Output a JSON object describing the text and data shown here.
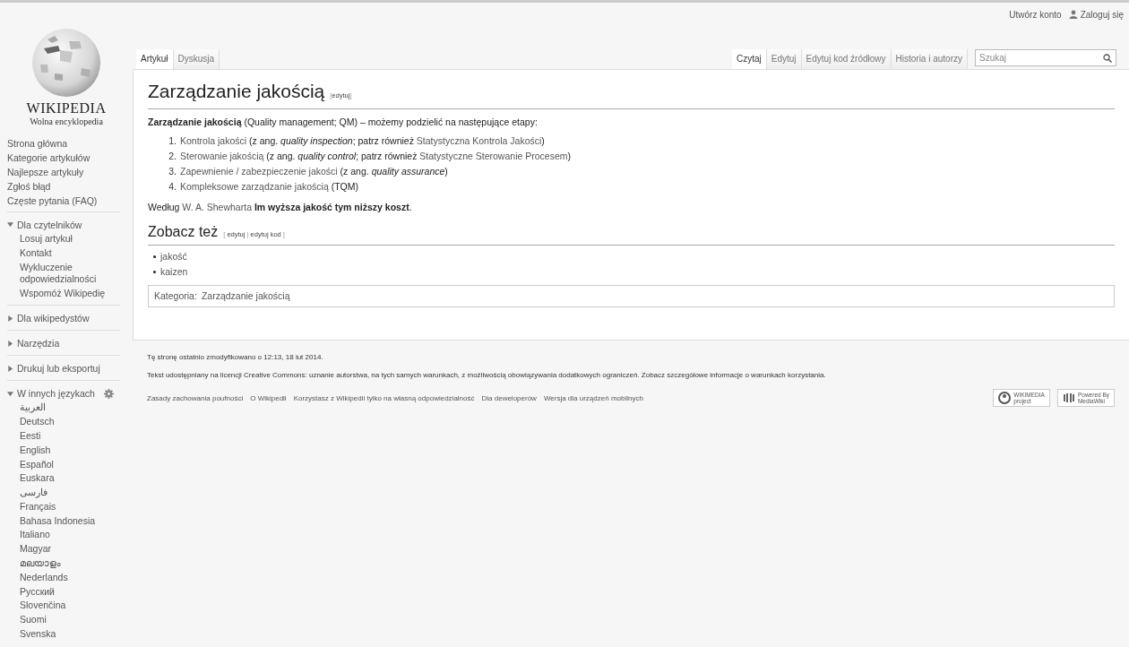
{
  "logo": {
    "wordmark": "WIKIPEDIA",
    "tagline": "Wolna encyklopedia"
  },
  "personal_links": [
    {
      "label": "Utwórz konto",
      "kind": "plain"
    },
    {
      "label": "Zaloguj się",
      "kind": "user"
    }
  ],
  "left_tabs": [
    {
      "label": "Artykuł",
      "selected": true
    },
    {
      "label": "Dyskusja",
      "selected": false
    }
  ],
  "right_tabs": [
    {
      "label": "Czytaj",
      "selected": true
    },
    {
      "label": "Edytuj",
      "selected": false
    },
    {
      "label": "Edytuj kod źródłowy",
      "selected": false
    },
    {
      "label": "Historia i autorzy",
      "selected": false
    }
  ],
  "search": {
    "placeholder": "Szukaj"
  },
  "sidebar": {
    "navigation": [
      "Strona główna",
      "Kategorie artykułów",
      "Najlepsze artykuły",
      "Zgłoś błąd",
      "Częste pytania (FAQ)"
    ],
    "portals": [
      {
        "title": "Dla czytelników",
        "expanded": true,
        "settings": false,
        "items": [
          "Losuj artykuł",
          "Kontakt",
          "Wykluczenie odpowiedzialności",
          "Wspomóż Wikipedię"
        ]
      },
      {
        "title": "Dla wikipedystów",
        "expanded": false,
        "settings": false
      },
      {
        "title": "Narzędzia",
        "expanded": false,
        "settings": false
      },
      {
        "title": "Drukuj lub eksportuj",
        "expanded": false,
        "settings": false
      },
      {
        "title": "W innych językach",
        "expanded": true,
        "settings": true,
        "items": [
          "العربية",
          "Deutsch",
          "Eesti",
          "English",
          "Español",
          "Euskara",
          "فارسی",
          "Français",
          "Bahasa Indonesia",
          "Italiano",
          "Magyar",
          "മലയാളം",
          "Nederlands",
          "Русский",
          "Slovenčina",
          "Suomi",
          "Svenska"
        ]
      }
    ]
  },
  "article": {
    "title": "Zarządzanie jakością",
    "title_edit": [
      {
        "text": "[",
        "link": false
      },
      {
        "text": "edytuj",
        "link": true
      },
      {
        "text": "]",
        "link": false
      }
    ],
    "intro": [
      {
        "text": "**Zarządzanie jakością** (Quality management; QM) – możemy podzielić na następujące etapy:",
        "link": false
      }
    ],
    "steps": [
      {
        "number": "1.",
        "parts": [
          {
            "text": "Kontrola jakości",
            "link": true
          },
          {
            "text": " (z ang. *quality inspection*; patrz również ",
            "link": false
          },
          {
            "text": "Statystyczna Kontrola Jakości",
            "link": true
          },
          {
            "text": ")",
            "link": false
          }
        ]
      },
      {
        "number": "2.",
        "parts": [
          {
            "text": "Sterowanie jakością",
            "link": true
          },
          {
            "text": " (z ang. *quality control*; patrz również ",
            "link": false
          },
          {
            "text": "Statystyczne Sterowanie Procesem",
            "link": true
          },
          {
            "text": ")",
            "link": false
          }
        ]
      },
      {
        "number": "3.",
        "parts": [
          {
            "text": "Zapewnienie / zabezpieczenie jakości",
            "link": true
          },
          {
            "text": " (z ang. *quality assurance*)",
            "link": false
          }
        ]
      },
      {
        "number": "4.",
        "parts": [
          {
            "text": "Kompleksowe zarządzanie jakością",
            "link": true
          },
          {
            "text": " (TQM)",
            "link": false
          }
        ]
      }
    ],
    "closing": [
      {
        "text": "Według ",
        "link": false
      },
      {
        "text": "W. A. Shewharta",
        "link": true
      },
      {
        "text": " **Im wyższa jakość tym niższy koszt**.",
        "link": false
      }
    ],
    "see_also": {
      "title": "Zobacz też",
      "edit": [
        {
          "text": "[ ",
          "link": false
        },
        {
          "text": "edytuj",
          "link": true
        },
        {
          "text": " | ",
          "link": false
        },
        {
          "text": "edytuj kod",
          "link": true
        },
        {
          "text": " ]",
          "link": false
        }
      ],
      "items": [
        "jakość",
        "kaizen"
      ]
    },
    "categories": {
      "label": "Kategoria:",
      "items": [
        "Zarządzanie jakością"
      ]
    }
  },
  "footer": {
    "lines": [
      "Tę stronę ostatnio zmodyfikowano o 12:13, 18 lut 2014.",
      "Tekst udostępniany na licencji Creative Commons: uznanie autorstwa, na tych samych warunkach, z możliwością obowiązywania dodatkowych ograniczeń. Zobacz szczegółowe informacje o warunkach korzystania."
    ],
    "links": [
      "Zasady zachowania poufności",
      "O Wikipedii",
      "Korzystasz z Wikipedii tylko na własną odpowiedzialność",
      "Dla deweloperów",
      "Wersja dla urządzeń mobilnych"
    ],
    "badges": [
      {
        "kind": "wikimedia",
        "lines": [
          "WIKIMEDIA",
          "project"
        ]
      },
      {
        "kind": "mediawiki",
        "lines": [
          "Powered By",
          "MediaWiki"
        ]
      }
    ]
  }
}
